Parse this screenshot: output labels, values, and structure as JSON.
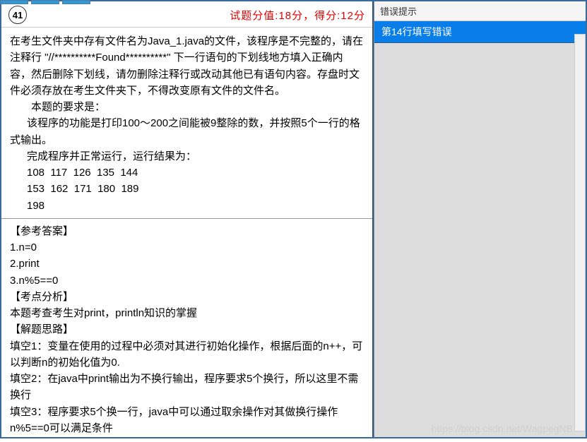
{
  "tabs": [
    "",
    "",
    ""
  ],
  "header": {
    "question_number": "41",
    "score_label": "试题分值:18分，得分:12分"
  },
  "question": {
    "p1": "在考生文件夹中存有文件名为Java_1.java的文件，该程序是不完整的，请在注释行 \"//**********Found**********\" 下一行语句的下划线地方填入正确内容，然后删除下划线，请勿删除注释行或改动其他已有语句内容。存盘时文件必须存放在考生文件夹下，不得改变原有文件的文件名。",
    "req_title": "本题的要求是：",
    "req_body": "该程序的功能是打印100～200之间能被9整除的数，并按照5个一行的格式输出。",
    "run_label": "完成程序并正常运行，运行结果为：",
    "out1": "108  117  126  135  144",
    "out2": "153  162  171  180  189",
    "out3": "198"
  },
  "answer": {
    "title_ref": "【参考答案】",
    "a1": "1.n=0",
    "a2": "2.print",
    "a3": "3.n%5==0",
    "title_point": "【考点分析】",
    "point_body": "本题考查考生对print，println知识的掌握",
    "title_think": "【解题思路】",
    "t1": "填空1：变量在使用的过程中必须对其进行初始化操作，根据后面的n++，可以判断n的初始化值为0.",
    "t2": "填空2：在java中print输出为不换行输出，程序要求5个换行，所以这里不需换行",
    "t3": "填空3：程序要求5个换一行，java中可以通过取余操作对其做换行操作n%5==0可以满足条件"
  },
  "right": {
    "header": "错误提示",
    "error1": "第14行填写错误"
  },
  "watermark": "https://blog.csdn.net/WagpegNB"
}
